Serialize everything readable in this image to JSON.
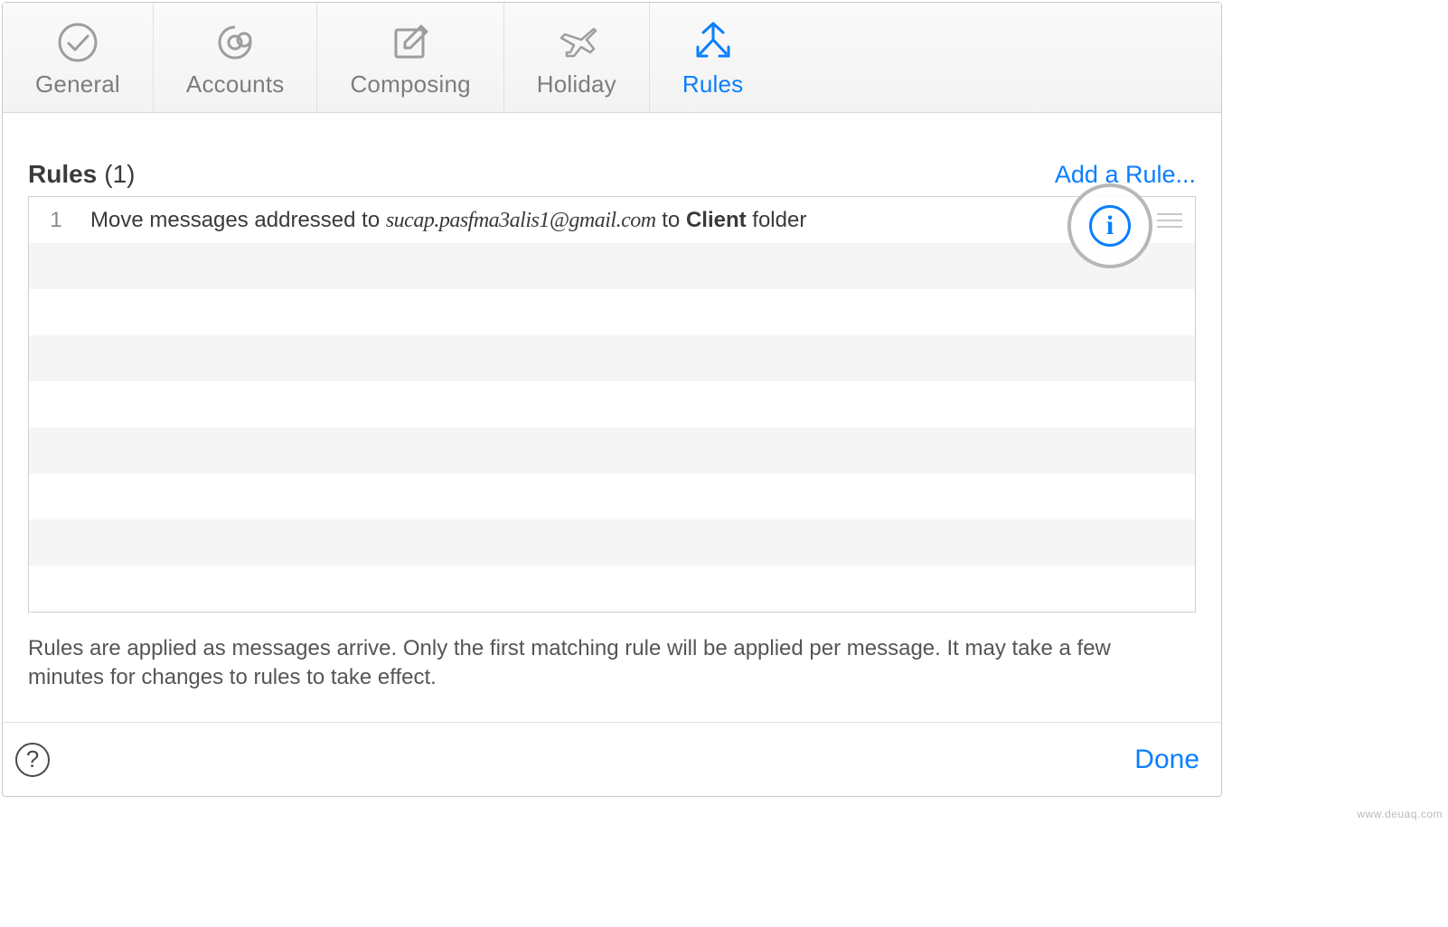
{
  "toolbar": {
    "tabs": [
      {
        "label": "General",
        "icon": "checkmark-circle-icon"
      },
      {
        "label": "Accounts",
        "icon": "at-sign-icon"
      },
      {
        "label": "Composing",
        "icon": "compose-icon"
      },
      {
        "label": "Holiday",
        "icon": "airplane-icon"
      },
      {
        "label": "Rules",
        "icon": "arrows-routing-icon"
      }
    ],
    "active_tab": "Rules"
  },
  "page": {
    "title": "Rules",
    "count_display": "(1)",
    "add_rule_label": "Add a Rule...",
    "help_text": "Rules are applied as messages arrive. Only the first matching rule will be applied per message. It may take a few minutes for changes to rules to take effect."
  },
  "rules": [
    {
      "index": "1",
      "description_prefix": "Move messages addressed to ",
      "email": "sucap.pasfma3alis1@gmail.com",
      "description_mid": " to ",
      "folder": "Client",
      "description_suffix": " folder"
    }
  ],
  "footer": {
    "done_label": "Done",
    "help_label": "?"
  },
  "watermark": "www.deuaq.com"
}
